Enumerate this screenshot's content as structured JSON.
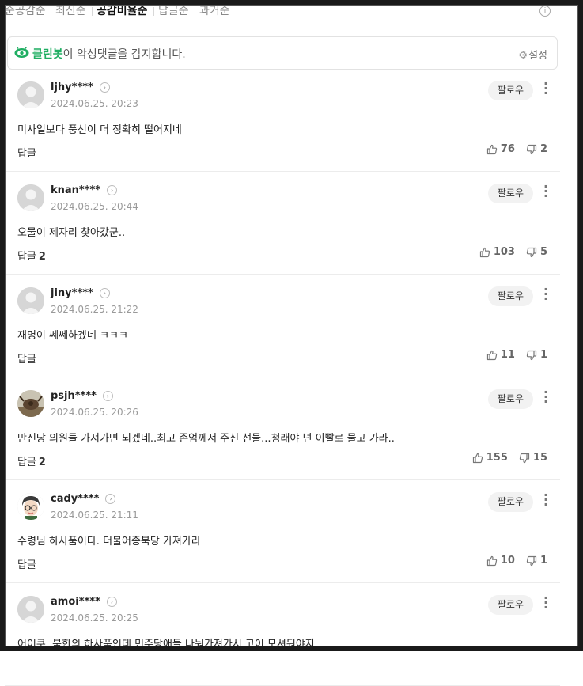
{
  "sort_tabs": [
    "순공감순",
    "최신순",
    "공감비율순",
    "답글순",
    "과거순"
  ],
  "active_tab": "공감비율순",
  "cleanbot": {
    "brand": "클린봇",
    "message": "이 악성댓글을 감지합니다.",
    "settings_label": "설정"
  },
  "follow_label": "팔로우",
  "reply_label": "답글",
  "comments": [
    {
      "nick": "ljhy****",
      "date": "2024.06.25. 20:23",
      "text": "미사일보다 풍선이 더 정확히 떨어지네",
      "replies": "",
      "likes": "76",
      "dislikes": "2",
      "avatar": "default"
    },
    {
      "nick": "knan****",
      "date": "2024.06.25. 20:44",
      "text": "오물이 제자리 찾아갔군..",
      "replies": "2",
      "likes": "103",
      "dislikes": "5",
      "avatar": "default"
    },
    {
      "nick": "jiny****",
      "date": "2024.06.25. 21:22",
      "text": "재명이 쎄쎄하겠네 ㅋㅋㅋ",
      "replies": "",
      "likes": "11",
      "dislikes": "1",
      "avatar": "default"
    },
    {
      "nick": "psjh****",
      "date": "2024.06.25. 20:26",
      "text": "만진당 의원들 가져가면 되겠네..최고 존엄께서 주신 선물...청래야 넌 이빨로 물고 가라..",
      "replies": "2",
      "likes": "155",
      "dislikes": "15",
      "avatar": "bull"
    },
    {
      "nick": "cady****",
      "date": "2024.06.25. 21:11",
      "text": "수령님 하사품이다. 더불어종북당 가져가라",
      "replies": "",
      "likes": "10",
      "dislikes": "1",
      "avatar": "face"
    },
    {
      "nick": "amoi****",
      "date": "2024.06.25. 20:25",
      "text": "어이쿠, 북한의 하사품인데 민주당애들 나눠가져가서 고이 모셔둬야지",
      "replies": "",
      "likes": "",
      "dislikes": "",
      "avatar": "default"
    }
  ],
  "colors": {
    "brand_green": "#1fae62",
    "muted": "#999999"
  },
  "icons": [
    "info-icon",
    "cleanbot-eye-icon",
    "gear-icon",
    "thumbs-up-icon",
    "thumbs-down-icon",
    "more-vertical-icon",
    "chevron-right-icon"
  ]
}
